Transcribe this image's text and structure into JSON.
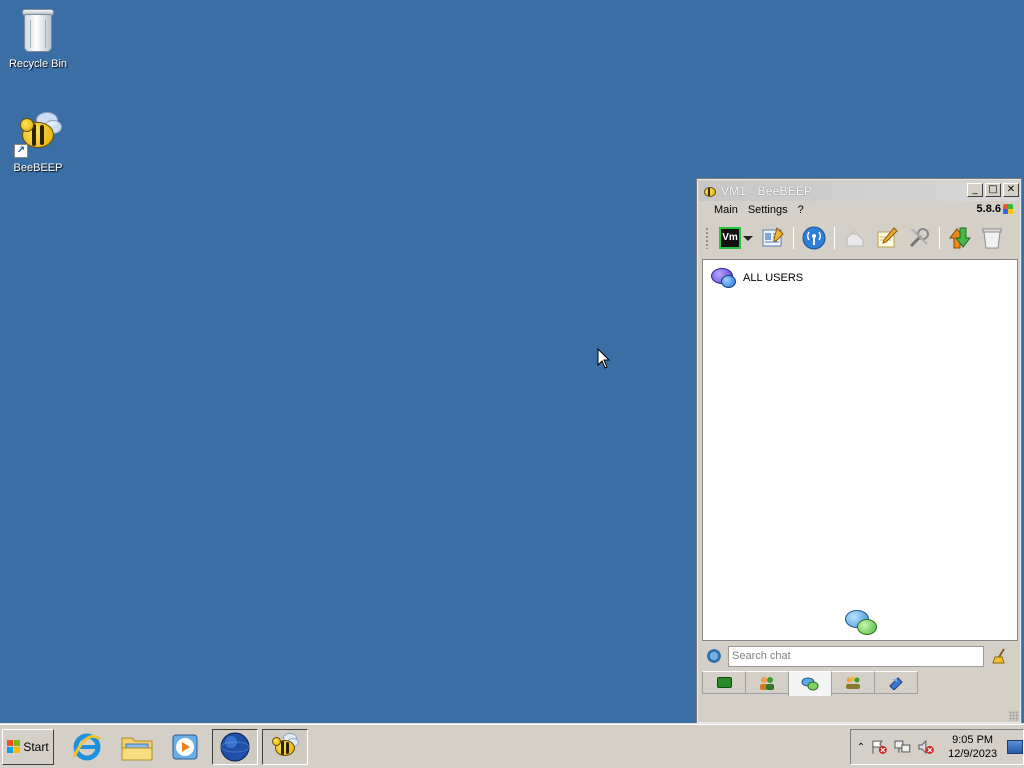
{
  "desktop": {
    "icons": [
      {
        "label": "Recycle Bin",
        "icon": "recycle-bin-icon"
      },
      {
        "label": "BeeBEEP",
        "icon": "beebeep-icon"
      }
    ]
  },
  "window": {
    "title": "VM1 - BeeBEEP",
    "controls": {
      "minimize": "_",
      "maximize": "□",
      "close": "✕"
    },
    "menu": [
      "Main",
      "Settings",
      "?"
    ],
    "version": "5.8.6",
    "toolbar": {
      "user_badge": "Vm",
      "buttons": [
        "user-status-icon",
        "profile-edit-icon",
        "network-icon",
        "plugins-icon",
        "notes-icon",
        "tools-icon",
        "file-transfer-icon",
        "close-chat-icon"
      ]
    },
    "chat_list": [
      {
        "label": "ALL USERS"
      }
    ],
    "search": {
      "placeholder": "Search chat",
      "value": ""
    },
    "tabs": [
      "home-tab",
      "users-tab",
      "chats-tab",
      "groups-tab",
      "shares-tab"
    ],
    "active_tab": "chats-tab"
  },
  "taskbar": {
    "start_label": "Start",
    "pinned": [
      "internet-explorer-icon",
      "file-explorer-icon",
      "media-player-icon",
      "network-globe-icon",
      "beebeep-icon"
    ],
    "tray": {
      "time": "9:05 PM",
      "date": "12/9/2023"
    }
  },
  "colors": {
    "desktop": "#3a6ea5",
    "chrome": "#d4d0c8",
    "accent": "#29c43b"
  }
}
